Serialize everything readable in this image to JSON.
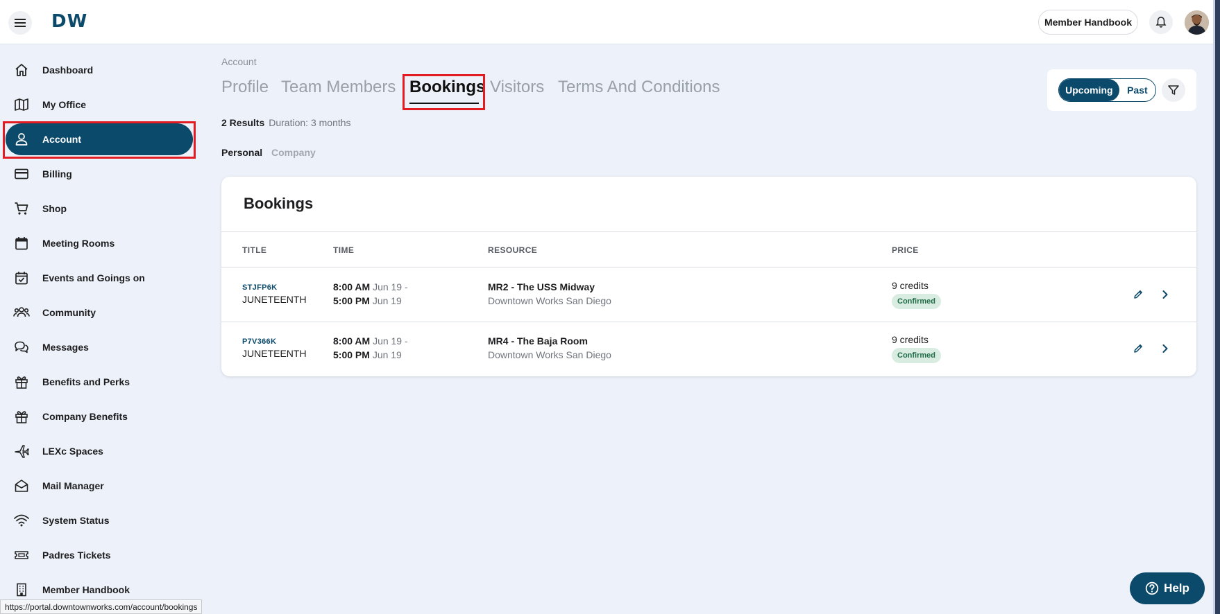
{
  "header": {
    "logo_text": "DW",
    "handbook_button": "Member Handbook",
    "icons": {
      "menu": "hamburger-menu-icon",
      "bell": "bell-icon",
      "avatar": "user-avatar"
    }
  },
  "sidebar": {
    "items": [
      {
        "label": "Dashboard",
        "icon": "home-icon",
        "active": false
      },
      {
        "label": "My Office",
        "icon": "map-icon",
        "active": false
      },
      {
        "label": "Account",
        "icon": "user-icon",
        "active": true
      },
      {
        "label": "Billing",
        "icon": "credit-card-icon",
        "active": false
      },
      {
        "label": "Shop",
        "icon": "cart-icon",
        "active": false
      },
      {
        "label": "Meeting Rooms",
        "icon": "calendar-icon",
        "active": false
      },
      {
        "label": "Events and Goings on",
        "icon": "calendar-check-icon",
        "active": false
      },
      {
        "label": "Community",
        "icon": "people-icon",
        "active": false
      },
      {
        "label": "Messages",
        "icon": "chat-icon",
        "active": false
      },
      {
        "label": "Benefits and Perks",
        "icon": "gift-icon",
        "active": false
      },
      {
        "label": "Company Benefits",
        "icon": "gift-icon",
        "active": false
      },
      {
        "label": "LEXc Spaces",
        "icon": "plane-icon",
        "active": false
      },
      {
        "label": "Mail Manager",
        "icon": "mail-open-icon",
        "active": false
      },
      {
        "label": "System Status",
        "icon": "wifi-icon",
        "active": false
      },
      {
        "label": "Padres Tickets",
        "icon": "ticket-icon",
        "active": false
      },
      {
        "label": "Member Handbook",
        "icon": "building-icon",
        "active": false
      }
    ]
  },
  "main": {
    "breadcrumb": "Account",
    "tabs": [
      {
        "label": "Profile",
        "active": false
      },
      {
        "label": "Team Members",
        "active": false
      },
      {
        "label": "Bookings",
        "active": true
      },
      {
        "label": "Visitors",
        "active": false
      },
      {
        "label": "Terms And Conditions",
        "active": false
      }
    ],
    "results_count": "2 Results",
    "results_duration": "Duration: 3 months",
    "subtabs": [
      {
        "label": "Personal",
        "active": true
      },
      {
        "label": "Company",
        "active": false
      }
    ],
    "view_toggle": {
      "upcoming": "Upcoming",
      "past": "Past",
      "selected": "Upcoming"
    },
    "filter_icon": "filter-icon"
  },
  "bookings": {
    "title": "Bookings",
    "columns": {
      "title": "TITLE",
      "time": "TIME",
      "resource": "RESOURCE",
      "price": "PRICE"
    },
    "rows": [
      {
        "code": "STJFP6K",
        "title": "JUNETEENTH",
        "start_time": "8:00 AM",
        "start_date": "Jun 19 -",
        "end_time": "5:00 PM",
        "end_date": "Jun 19",
        "resource": "MR2 - The USS Midway",
        "location": "Downtown Works San Diego",
        "price": "9 credits",
        "status": "Confirmed"
      },
      {
        "code": "P7V366K",
        "title": "JUNETEENTH",
        "start_time": "8:00 AM",
        "start_date": "Jun 19 -",
        "end_time": "5:00 PM",
        "end_date": "Jun 19",
        "resource": "MR4 - The Baja Room",
        "location": "Downtown Works San Diego",
        "price": "9 credits",
        "status": "Confirmed"
      }
    ]
  },
  "status_url": "https://portal.downtownworks.com/account/bookings",
  "help_button": "Help",
  "colors": {
    "brand": "#0c4a6b",
    "highlight": "#e31b23",
    "confirmed_bg": "#d9ece2",
    "confirmed_text": "#1e6b45"
  }
}
